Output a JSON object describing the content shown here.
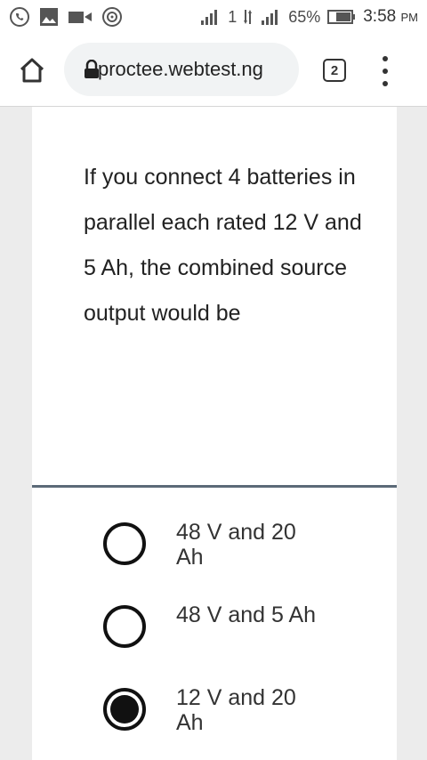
{
  "status_bar": {
    "signal_label": "1",
    "battery_percent": "65%",
    "time": "3:58",
    "time_suffix": "PM"
  },
  "browser": {
    "url": "proctee.webtest.ng",
    "tab_count": "2"
  },
  "question": {
    "text": "If you connect 4 batteries in parallel each rated 12 V and 5 Ah, the combined source output would be"
  },
  "options": [
    {
      "label": "48 V and 20 Ah",
      "selected": false
    },
    {
      "label": "48 V and 5 Ah",
      "selected": false
    },
    {
      "label": "12 V and 20 Ah",
      "selected": true
    }
  ]
}
